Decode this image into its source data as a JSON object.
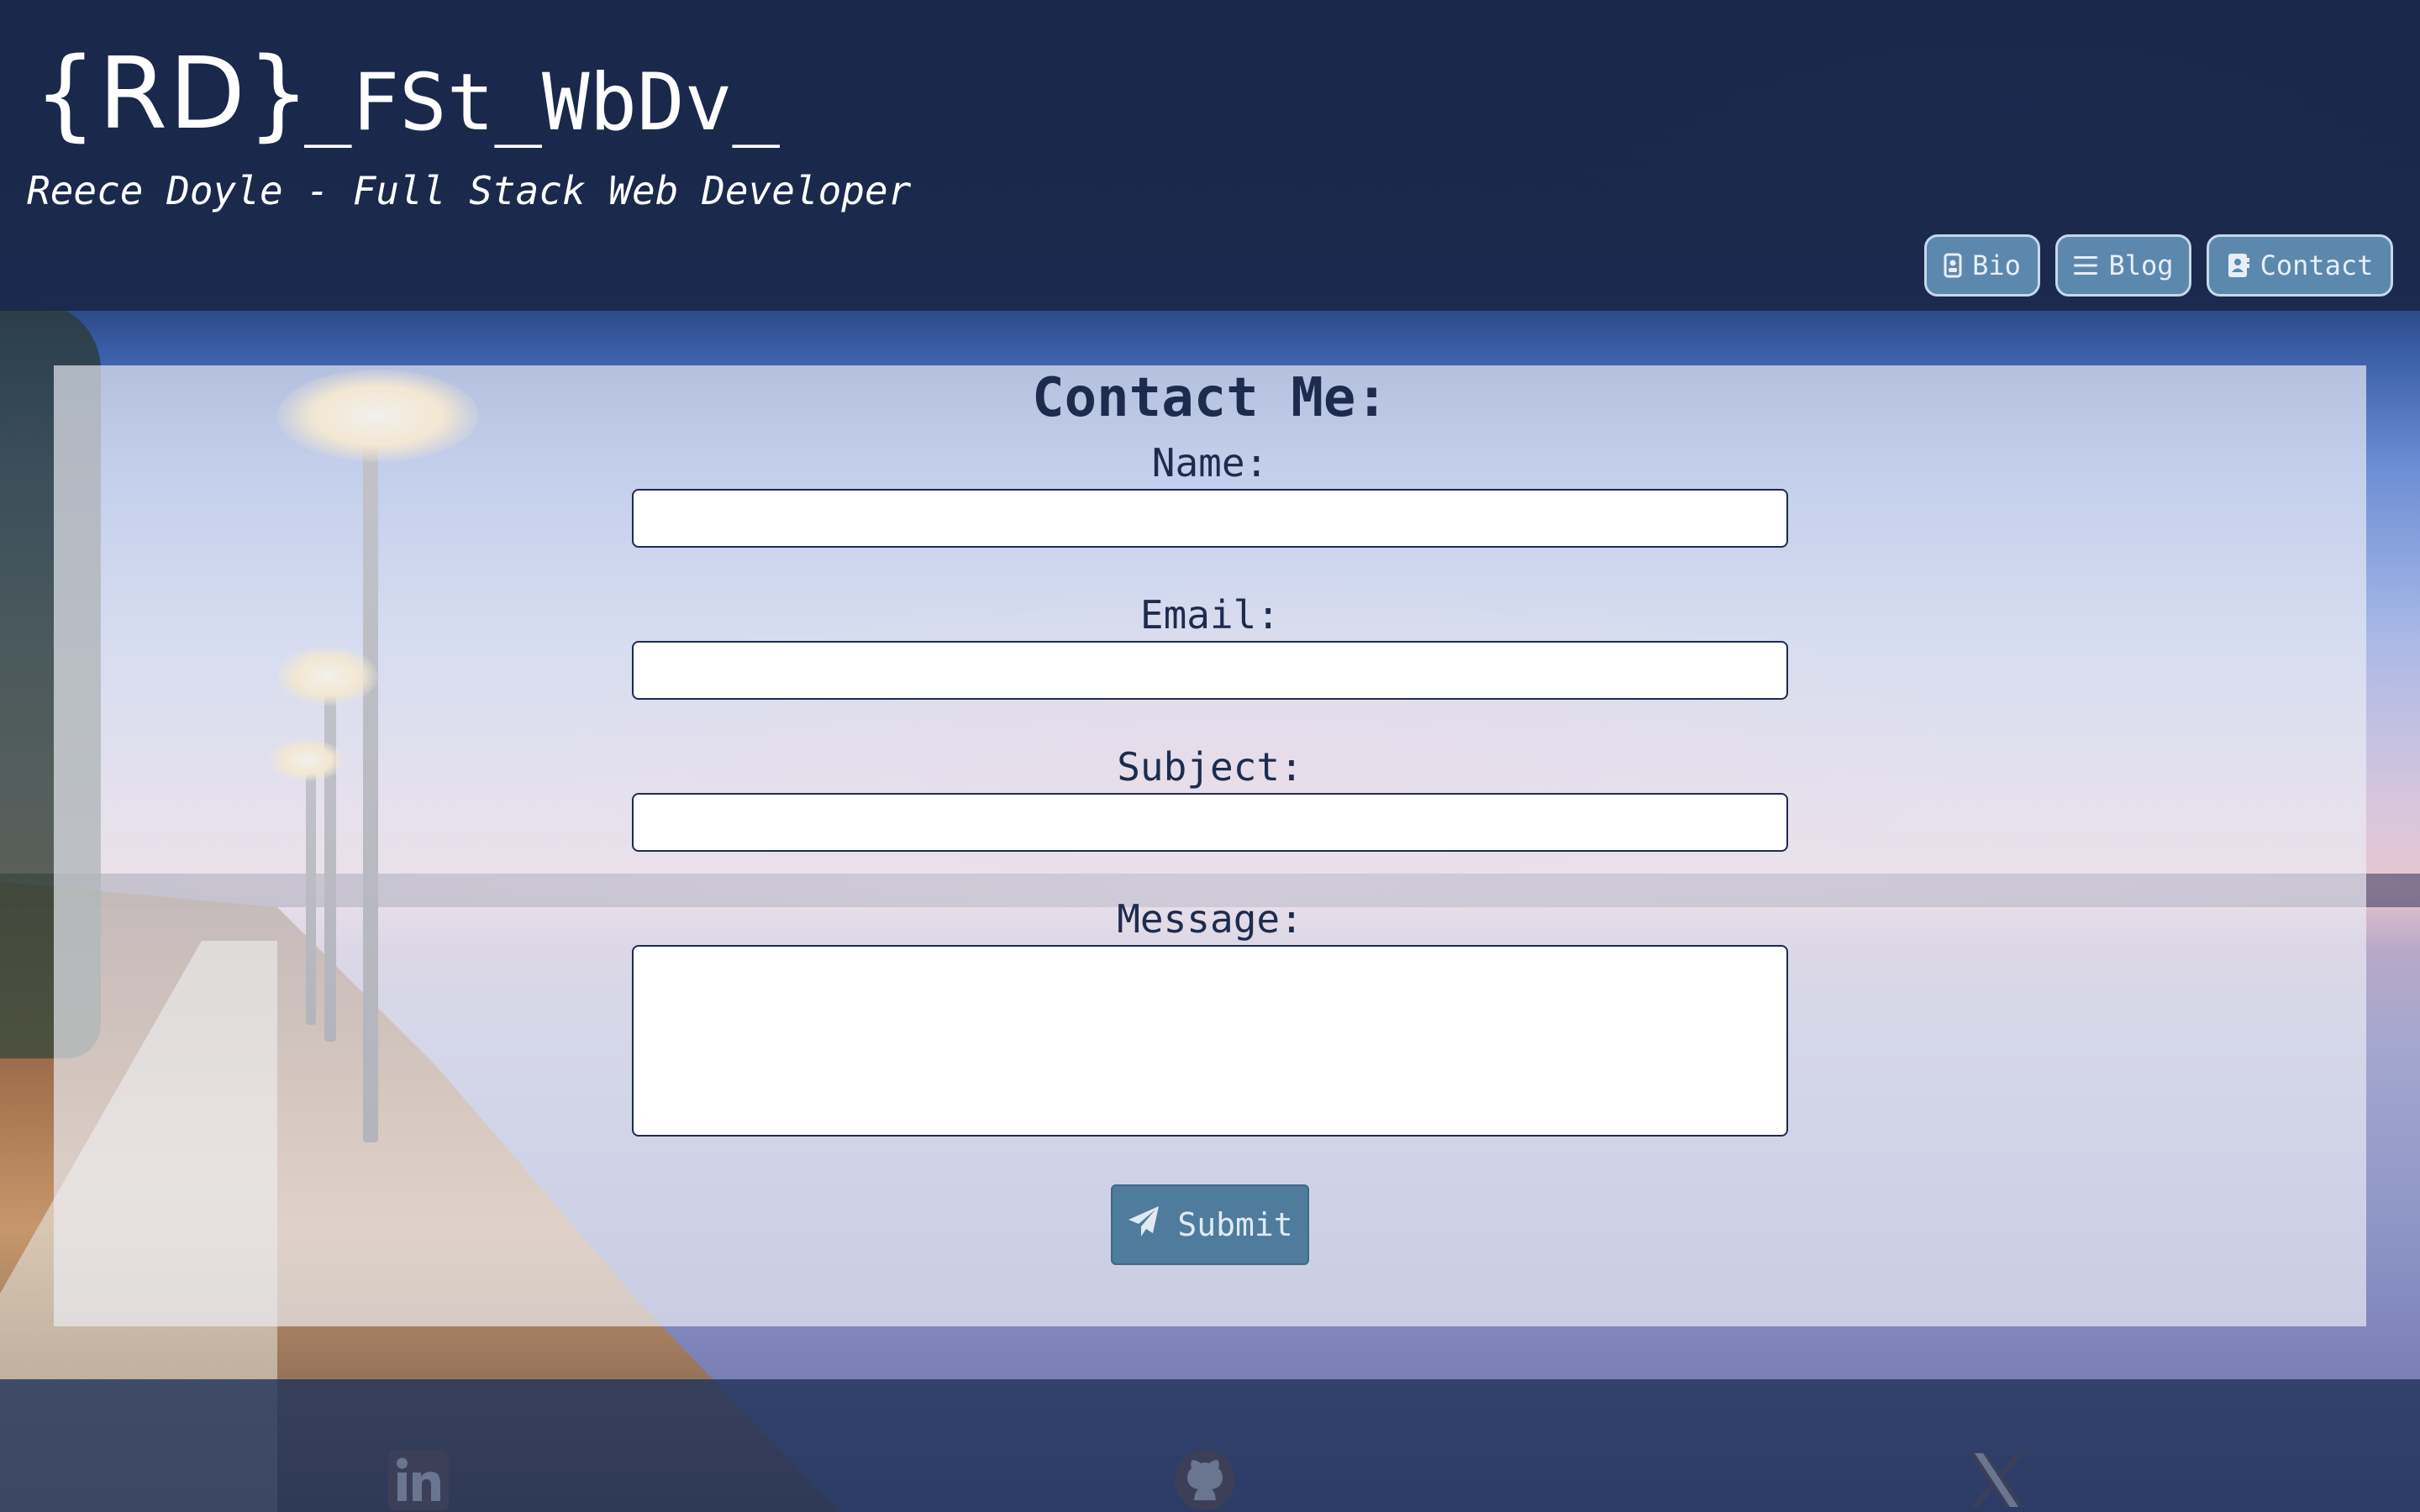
{
  "header": {
    "logo_mark": "{RD}",
    "logo_text": "_FSt_WbDv_",
    "tagline": "Reece Doyle - Full Stack Web Developer"
  },
  "nav": {
    "items": [
      {
        "label": "Bio",
        "icon": "id-badge-icon"
      },
      {
        "label": "Blog",
        "icon": "menu-lines-icon"
      },
      {
        "label": "Contact",
        "icon": "address-book-icon"
      }
    ]
  },
  "contact_form": {
    "title": "Contact Me:",
    "fields": {
      "name": {
        "label": "Name:",
        "value": ""
      },
      "email": {
        "label": "Email:",
        "value": ""
      },
      "subject": {
        "label": "Subject:",
        "value": ""
      },
      "message": {
        "label": "Message:",
        "value": ""
      }
    },
    "submit": {
      "label": "Submit",
      "icon": "paper-plane-icon"
    }
  },
  "footer": {
    "social": [
      {
        "name": "LinkedIn",
        "icon": "linkedin-icon"
      },
      {
        "name": "GitHub",
        "icon": "github-icon"
      },
      {
        "name": "X",
        "icon": "x-twitter-icon"
      }
    ]
  },
  "colors": {
    "header_bg": "#1a284a",
    "nav_button_bg": "#5d88ad",
    "card_text": "#1d2c4e",
    "submit_bg": "#4f7b9c",
    "footer_icon": "#3b3f58"
  }
}
